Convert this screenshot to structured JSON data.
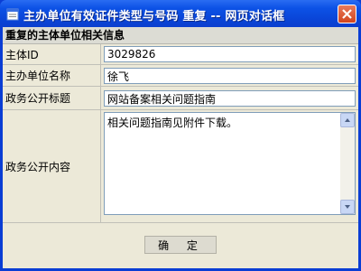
{
  "window": {
    "title": "主办单位有效证件类型与号码 重复 -- 网页对话框"
  },
  "section": {
    "header": "重复的主体单位相关信息"
  },
  "fields": {
    "subject_id_label": "主体ID",
    "subject_id_value": "3029826",
    "sponsor_name_label": "主办单位名称",
    "sponsor_name_value": "徐飞",
    "gov_title_label": "政务公开标题",
    "gov_title_value": "网站备案相关问题指南",
    "gov_content_label": "政务公开内容",
    "gov_content_value": "相关问题指南见附件下载。"
  },
  "buttons": {
    "ok_label": "确 定"
  },
  "colors": {
    "titlebar": "#0c52e6",
    "client_bg": "#ece9d8",
    "close_button": "#d2451f"
  }
}
